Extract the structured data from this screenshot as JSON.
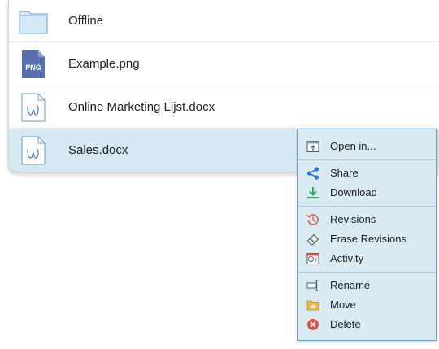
{
  "files": [
    {
      "name": "Offline",
      "icon": "folder-icon",
      "selected": false
    },
    {
      "name": "Example.png",
      "icon": "png-file-icon",
      "icon_text": "PNG",
      "selected": false
    },
    {
      "name": "Online Marketing Lijst.docx",
      "icon": "document-icon",
      "selected": false
    },
    {
      "name": "Sales.docx",
      "icon": "document-icon",
      "selected": true
    }
  ],
  "context_menu": {
    "items": [
      {
        "label": "Open in...",
        "icon": "open-in-icon"
      },
      {
        "label": "Share",
        "icon": "share-icon"
      },
      {
        "label": "Download",
        "icon": "download-icon"
      },
      {
        "label": "Revisions",
        "icon": "revisions-icon"
      },
      {
        "label": "Erase Revisions",
        "icon": "eraser-icon"
      },
      {
        "label": "Activity",
        "icon": "activity-icon"
      },
      {
        "label": "Rename",
        "icon": "rename-icon"
      },
      {
        "label": "Move",
        "icon": "move-folder-icon"
      },
      {
        "label": "Delete",
        "icon": "delete-icon"
      }
    ]
  },
  "colors": {
    "selected_row": "#d6e8f2",
    "menu_background": "#d9eaf3",
    "menu_border": "#6b9cc6",
    "folder": "#cde4f2",
    "png_icon": "#5a6fb0",
    "share": "#2b7bd4",
    "download": "#3aa35a",
    "revisions": "#d9534f",
    "delete": "#d9534f"
  }
}
